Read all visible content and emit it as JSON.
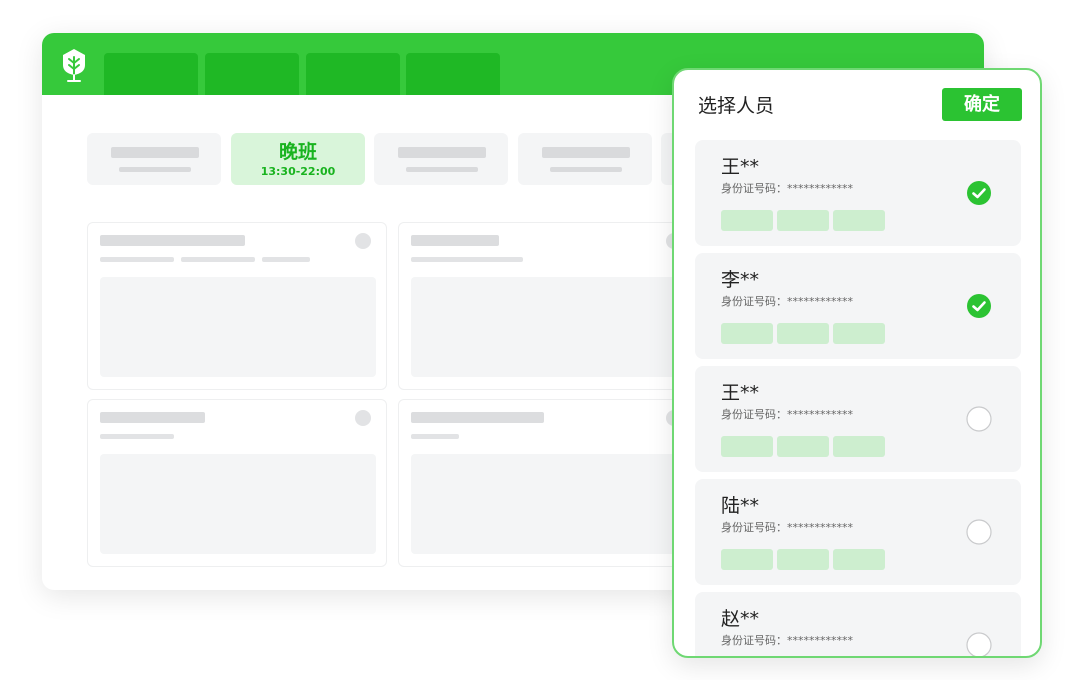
{
  "schedule": {
    "active_shift": {
      "name": "晚班",
      "time": "13:30-22:00"
    }
  },
  "modal": {
    "title": "选择人员",
    "confirm_label": "确定",
    "people": [
      {
        "name": "王**",
        "id_label": "身份证号码：",
        "id_value": "************",
        "selected": true
      },
      {
        "name": "李**",
        "id_label": "身份证号码：",
        "id_value": "************",
        "selected": true
      },
      {
        "name": "王**",
        "id_label": "身份证号码：",
        "id_value": "************",
        "selected": false
      },
      {
        "name": "陆**",
        "id_label": "身份证号码：",
        "id_value": "************",
        "selected": false
      },
      {
        "name": "赵**",
        "id_label": "身份证号码：",
        "id_value": "************",
        "selected": false
      }
    ]
  },
  "colors": {
    "brand": "#36c93b",
    "accent": "#2bc332",
    "check_selected": "#2bc332"
  }
}
